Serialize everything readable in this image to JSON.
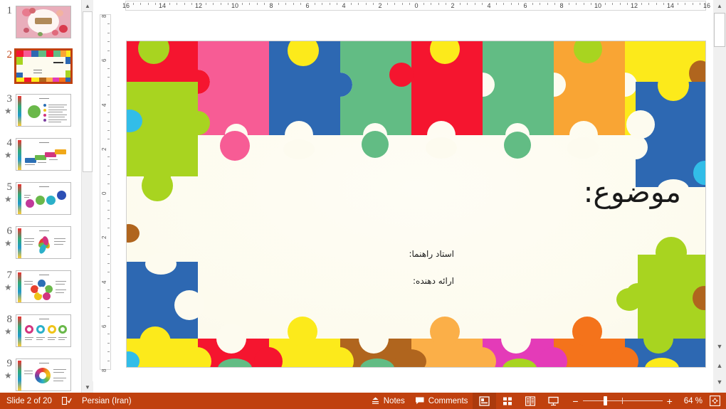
{
  "app": {
    "name": "PowerPoint",
    "view": "Normal"
  },
  "rulers": {
    "horizontal": {
      "labels": [
        16,
        14,
        12,
        10,
        8,
        6,
        4,
        2,
        0,
        2,
        4,
        6,
        8,
        10,
        12,
        14,
        16
      ],
      "unit": "cm"
    },
    "vertical": {
      "labels": [
        8,
        6,
        4,
        2,
        0,
        2,
        4,
        6,
        8
      ],
      "unit": "cm"
    }
  },
  "thumbnails": {
    "selected_index": 2,
    "items": [
      {
        "number": "1",
        "animated": false,
        "style": "pink-floral"
      },
      {
        "number": "2",
        "animated": false,
        "style": "puzzle-title"
      },
      {
        "number": "3",
        "animated": true,
        "style": "circle-bullets"
      },
      {
        "number": "4",
        "animated": true,
        "style": "bars-chart"
      },
      {
        "number": "5",
        "animated": true,
        "style": "four-circles"
      },
      {
        "number": "6",
        "animated": true,
        "style": "flower-petals"
      },
      {
        "number": "7",
        "animated": true,
        "style": "five-lobes"
      },
      {
        "number": "8",
        "animated": true,
        "style": "four-rings"
      },
      {
        "number": "9",
        "animated": true,
        "style": "color-wheel"
      }
    ]
  },
  "slide": {
    "title": "موضوع:",
    "supervisor_label": "استاد راهنما:",
    "presenter_label": "ارائه دهنده:",
    "background_color": "#FDFBEF",
    "border_theme": "jigsaw-puzzle",
    "puzzle_colors": {
      "red": "#F5152F",
      "pink": "#F75C95",
      "blue": "#2D68B2",
      "green": "#62BC84",
      "lightgreen": "#A8D420",
      "yellow": "#FCEA1B",
      "orange": "#F9A534",
      "deep_orange": "#F4731B",
      "magenta": "#E43BB8",
      "brown": "#B0651E",
      "cyan": "#32BDE8",
      "sand": "#FBAF48"
    }
  },
  "statusbar": {
    "slide_counter": "Slide 2 of 20",
    "language": "Persian (Iran)",
    "spellcheck_icon": "proofing-icon",
    "notes_label": "Notes",
    "comments_label": "Comments",
    "views": [
      {
        "name": "Normal",
        "icon": "normal-view-icon",
        "active": true
      },
      {
        "name": "Slide Sorter",
        "icon": "slide-sorter-icon",
        "active": false
      },
      {
        "name": "Reading View",
        "icon": "reading-view-icon",
        "active": false
      },
      {
        "name": "Slide Show",
        "icon": "slide-show-icon",
        "active": false
      }
    ],
    "zoom_out": "−",
    "zoom_in": "+",
    "zoom_level": "64 %",
    "fit_label": "fit-to-window-icon",
    "accent_color": "#C0410F"
  }
}
